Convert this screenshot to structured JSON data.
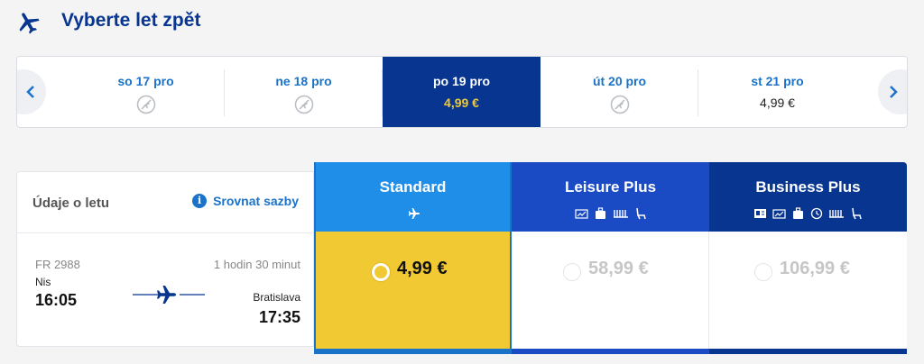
{
  "header": {
    "title": "Vyberte let zpět",
    "icon": "plane-return-icon"
  },
  "date_strip": {
    "prev_icon": "chevron-left-icon",
    "next_icon": "chevron-right-icon",
    "dates": [
      {
        "day": "so 17 pro",
        "price": "",
        "available": false
      },
      {
        "day": "ne 18 pro",
        "price": "",
        "available": false
      },
      {
        "day": "po 19 pro",
        "price": "4,99 €",
        "available": true,
        "selected": true
      },
      {
        "day": "út 20 pro",
        "price": "",
        "available": false
      },
      {
        "day": "st 21 pro",
        "price": "4,99 €",
        "available": true
      }
    ]
  },
  "flight": {
    "header_label": "Údaje o letu",
    "compare_label": "Srovnat sazby",
    "flight_number": "FR 2988",
    "origin": "Nis",
    "departure_time": "16:05",
    "duration": "1 hodin 30 minut",
    "destination": "Bratislava",
    "arrival_time": "17:35"
  },
  "fares": [
    {
      "name": "Standard",
      "price": "4,99 €",
      "selected": true,
      "icons": [
        "plane-icon"
      ]
    },
    {
      "name": "Leisure Plus",
      "price": "58,99 €",
      "selected": false,
      "icons": [
        "flexible-ticket-icon",
        "cabin-bag-icon",
        "seat-row-icon",
        "reserved-seat-icon"
      ]
    },
    {
      "name": "Business Plus",
      "price": "106,99 €",
      "selected": false,
      "icons": [
        "id-card-icon",
        "flexible-ticket-icon",
        "cabin-bag-icon",
        "fast-track-icon",
        "seat-row-icon",
        "reserved-seat-icon"
      ]
    }
  ],
  "colors": {
    "navy": "#073590",
    "accent_blue": "#1a73c9",
    "standard_blue": "#1f8ee8",
    "leisure_blue": "#1a4bc4",
    "yellow": "#f1c933"
  }
}
